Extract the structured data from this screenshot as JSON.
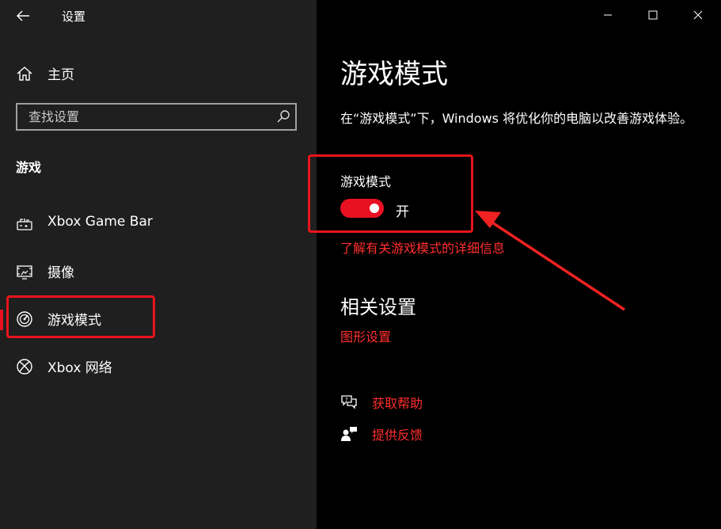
{
  "window": {
    "app_title": "设置",
    "controls": [
      "minimize",
      "maximize",
      "close"
    ]
  },
  "sidebar": {
    "home_label": "主页",
    "search": {
      "placeholder": "查找设置",
      "value": ""
    },
    "section_label": "游戏",
    "items": [
      {
        "label": "Xbox Game Bar",
        "icon": "game-bar-icon",
        "active": false
      },
      {
        "label": "摄像",
        "icon": "capture-icon",
        "active": false
      },
      {
        "label": "游戏模式",
        "icon": "game-mode-icon",
        "active": true
      },
      {
        "label": "Xbox 网络",
        "icon": "xbox-icon",
        "active": false
      }
    ]
  },
  "main": {
    "title": "游戏模式",
    "description": "在“游戏模式”下，Windows 将优化你的电脑以改善游戏体验。",
    "toggle": {
      "label": "游戏模式",
      "state_text": "开",
      "on": true
    },
    "learn_more_link": "了解有关游戏模式的详细信息",
    "related_heading": "相关设置",
    "related_links": [
      "图形设置"
    ],
    "help": [
      {
        "label": "获取帮助",
        "icon": "help-chat-icon"
      },
      {
        "label": "提供反馈",
        "icon": "feedback-icon"
      }
    ]
  },
  "colors": {
    "accent": "#e81123",
    "link": "#ff2e2e",
    "sidebar_bg": "#1f1f1f",
    "content_bg": "#000000",
    "annotation": "#e8141c"
  }
}
